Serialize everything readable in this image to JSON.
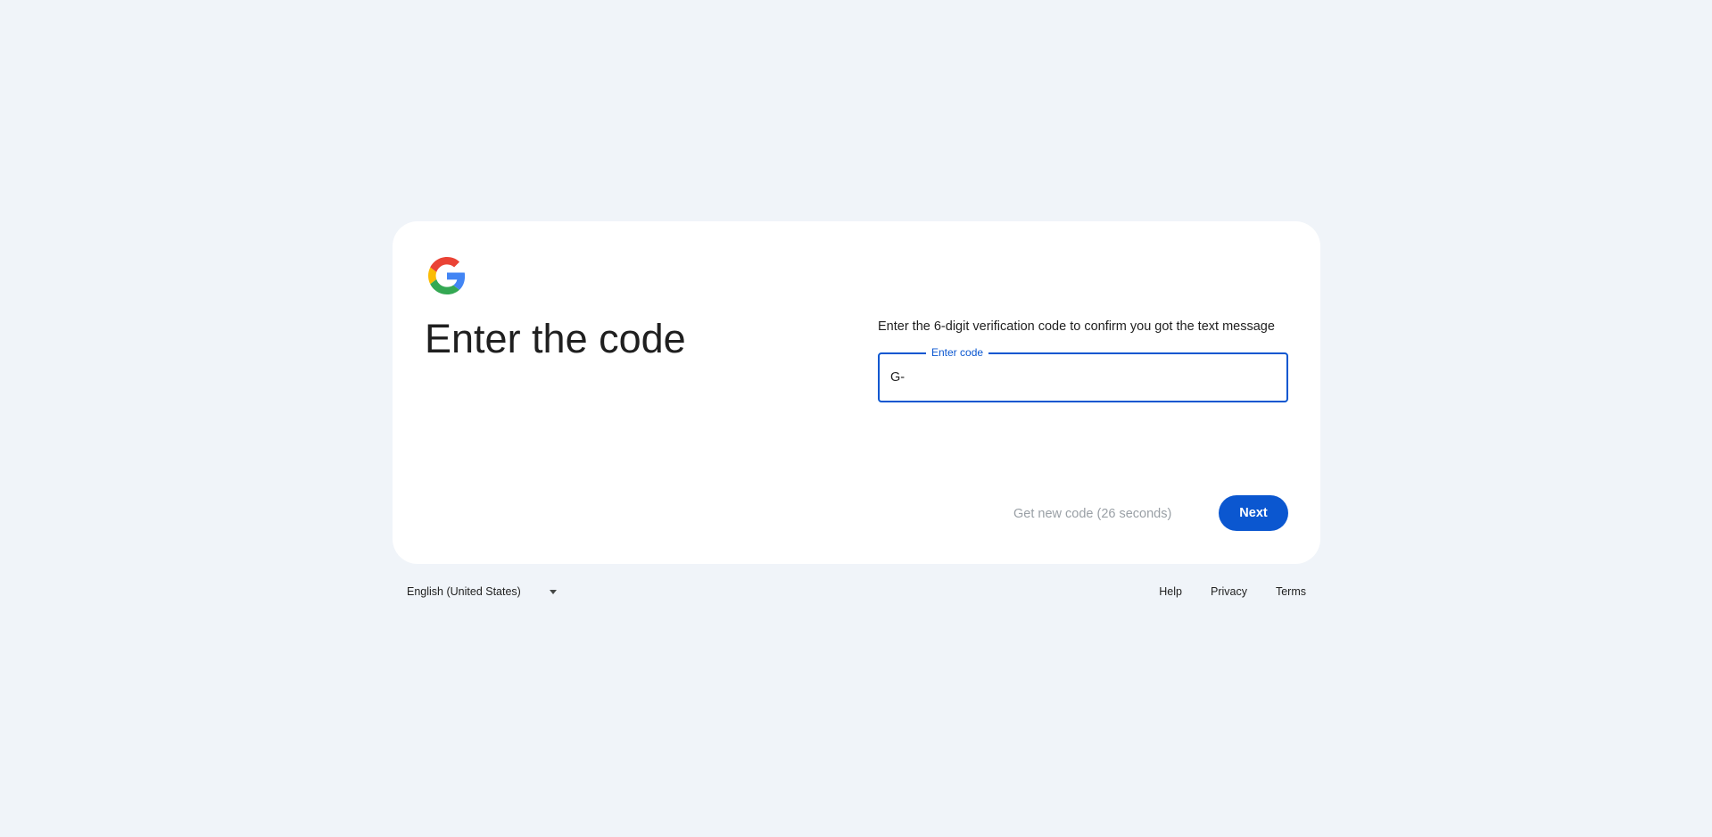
{
  "logo": {
    "icon": "google-g-icon",
    "colors": [
      "#4285F4",
      "#EA4335",
      "#FBBC05",
      "#34A853"
    ]
  },
  "headline": "Enter the code",
  "instructions": "Enter the 6-digit verification code to confirm you got the text message",
  "code_field": {
    "label": "Enter code",
    "value": "G-",
    "border_color": "#0b57d0"
  },
  "actions": {
    "resend_label": "Get new code (26 seconds)",
    "next_label": "Next",
    "accent": "#0b57d0"
  },
  "footer": {
    "language": "English (United States)",
    "links": [
      "Help",
      "Privacy",
      "Terms"
    ]
  }
}
